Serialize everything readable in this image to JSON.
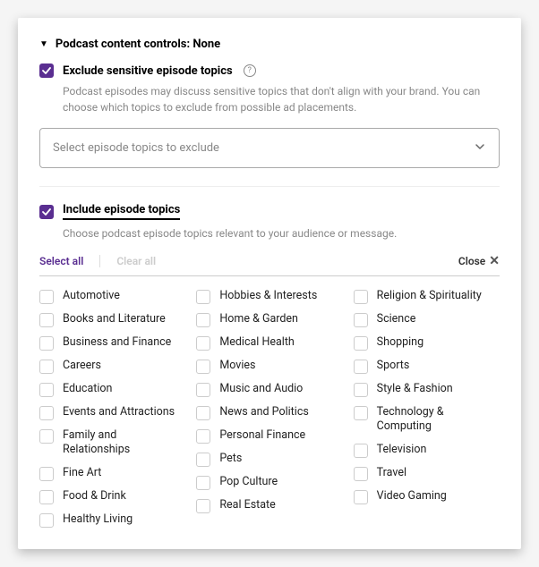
{
  "header": {
    "title": "Podcast content controls: None"
  },
  "exclude": {
    "checkbox_label": "Exclude sensitive episode topics",
    "description": "Podcast episodes may discuss sensitive topics that don't align with your brand. You can choose which topics to exclude from possible ad placements.",
    "select_placeholder": "Select episode topics to exclude"
  },
  "include": {
    "checkbox_label": "Include episode topics",
    "description": "Choose podcast episode topics relevant to your audience or message."
  },
  "actions": {
    "select_all": "Select all",
    "clear_all": "Clear all",
    "close": "Close"
  },
  "topics": {
    "col1": [
      "Automotive",
      "Books and Literature",
      "Business and Finance",
      "Careers",
      "Education",
      "Events and Attractions",
      "Family and Relationships",
      "Fine Art",
      "Food & Drink",
      "Healthy Living"
    ],
    "col2": [
      "Hobbies & Interests",
      "Home & Garden",
      "Medical Health",
      "Movies",
      "Music and Audio",
      "News and Politics",
      "Personal Finance",
      "Pets",
      "Pop Culture",
      "Real Estate"
    ],
    "col3": [
      "Religion & Spirituality",
      "Science",
      "Shopping",
      "Sports",
      "Style & Fashion",
      "Technology & Computing",
      "Television",
      "Travel",
      "Video Gaming"
    ]
  }
}
